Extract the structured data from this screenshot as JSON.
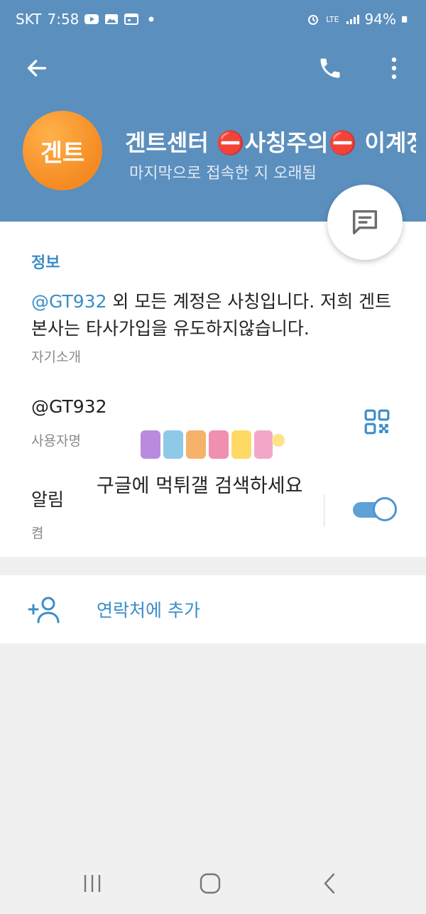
{
  "status_bar": {
    "carrier": "SKT",
    "time": "7:58",
    "network": "LTE",
    "battery": "94%"
  },
  "toolbar": {
    "back_icon": "arrow-left-icon",
    "call_icon": "phone-icon",
    "more_icon": "more-vertical-icon"
  },
  "profile": {
    "avatar_text": "겐트",
    "avatar_color": "#f58a22",
    "name": "겐트센터 ⛔사칭주의⛔ 이계정",
    "status": "마지막으로 접속한 지 오래됨"
  },
  "info": {
    "section_title": "정보",
    "bio_mention": "@GT932",
    "bio_rest": " 외 모든 계정은 사칭입니다. 저희 겐트본사는 타사가입을 유도하지않습니다.",
    "bio_label": "자기소개",
    "username": "@GT932",
    "username_label": "사용자명",
    "notifications_title": "알림",
    "notifications_value": "켬",
    "notifications_on": true
  },
  "watermark": {
    "text": "구글에 먹튀갤 검색하세요"
  },
  "actions": {
    "add_contact_label": "연락처에 추가"
  },
  "colors": {
    "header": "#5b8fbe",
    "accent": "#3b8ec8",
    "toggle": "#5ea1d6"
  }
}
